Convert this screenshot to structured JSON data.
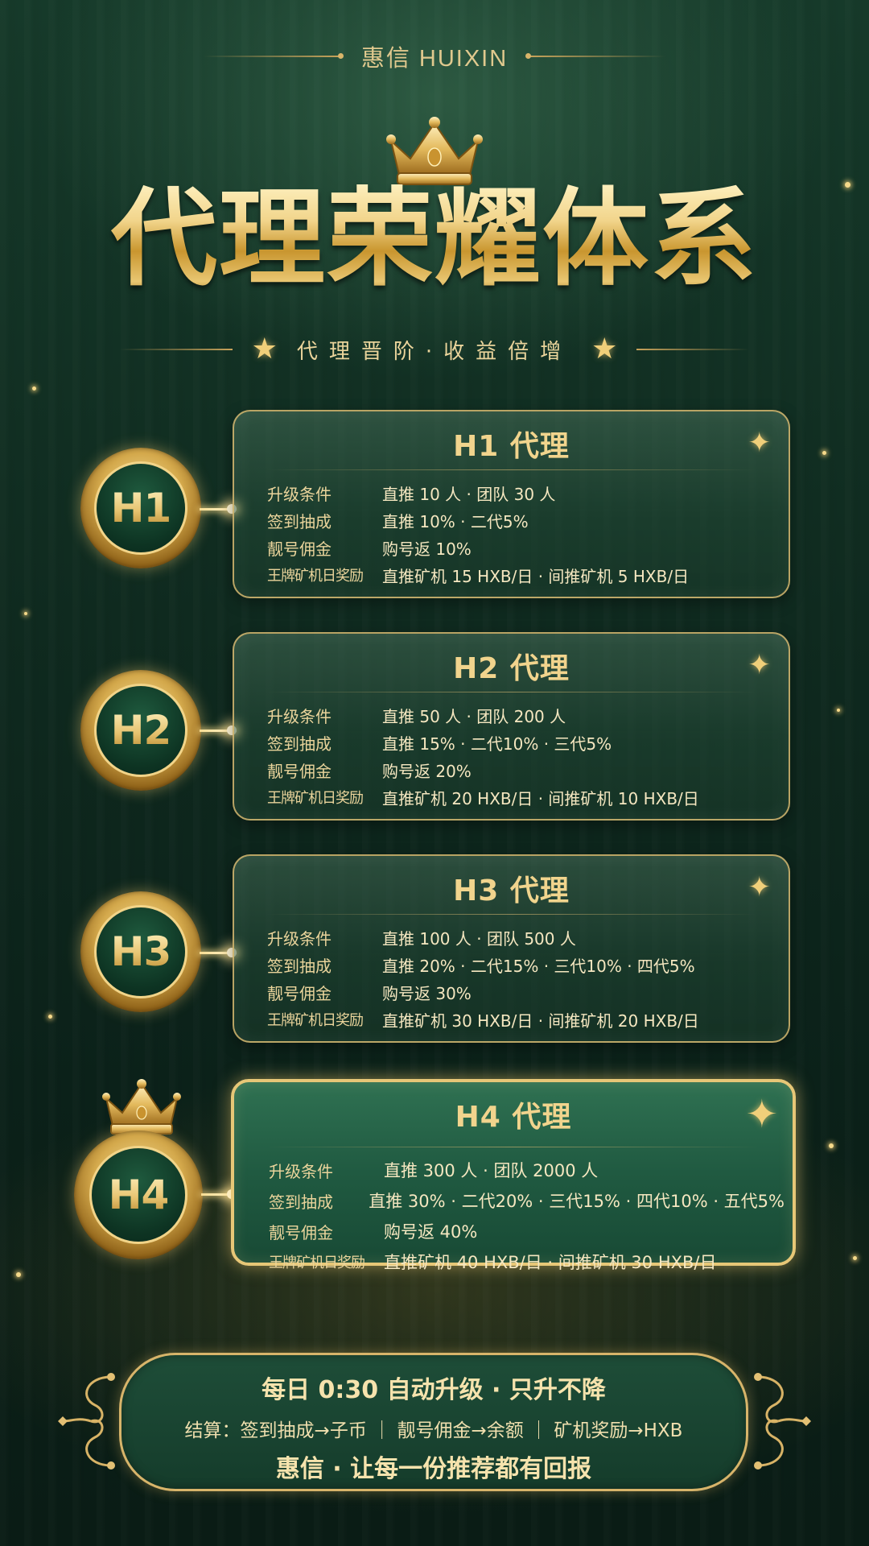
{
  "brand": "惠信 HUIXIN",
  "title": "代理荣耀体系",
  "subtitle": "代理晋阶·收益倍增",
  "levels": [
    {
      "badge": "H1",
      "title": "H1 代理",
      "rows": [
        {
          "label": "升级条件",
          "value": "直推 10 人 · 团队 30 人"
        },
        {
          "label": "签到抽成",
          "value": "直推 10% · 二代5%"
        },
        {
          "label": "靓号佣金",
          "value": "购号返 10%"
        },
        {
          "label": "王牌矿机日奖励",
          "value": "直推矿机 15 HXB/日 · 间推矿机 5 HXB/日"
        }
      ]
    },
    {
      "badge": "H2",
      "title": "H2 代理",
      "rows": [
        {
          "label": "升级条件",
          "value": "直推 50 人 · 团队 200 人"
        },
        {
          "label": "签到抽成",
          "value": "直推 15% · 二代10% · 三代5%"
        },
        {
          "label": "靓号佣金",
          "value": "购号返 20%"
        },
        {
          "label": "王牌矿机日奖励",
          "value": "直推矿机 20 HXB/日 · 间推矿机 10 HXB/日"
        }
      ]
    },
    {
      "badge": "H3",
      "title": "H3 代理",
      "rows": [
        {
          "label": "升级条件",
          "value": "直推 100 人 · 团队 500 人"
        },
        {
          "label": "签到抽成",
          "value": "直推 20% · 二代15% · 三代10% · 四代5%"
        },
        {
          "label": "靓号佣金",
          "value": "购号返 30%"
        },
        {
          "label": "王牌矿机日奖励",
          "value": "直推矿机 30 HXB/日 · 间推矿机 20 HXB/日"
        }
      ]
    },
    {
      "badge": "H4",
      "title": "H4 代理",
      "rows": [
        {
          "label": "升级条件",
          "value": "直推 300 人 · 团队 2000 人"
        },
        {
          "label": "签到抽成",
          "value": "直推 30% · 二代20% · 三代15% · 四代10% · 五代5%"
        },
        {
          "label": "靓号佣金",
          "value": "购号返 40%"
        },
        {
          "label": "王牌矿机日奖励",
          "value": "直推矿机 40 HXB/日 · 间推矿机 30 HXB/日"
        }
      ]
    }
  ],
  "footer": {
    "line1": "每日 0:30 自动升级 · 只升不降",
    "line2": "结算：签到抽成→子币 ｜ 靓号佣金→余额 ｜ 矿机奖励→HXB",
    "line3": "惠信 · 让每一份推荐都有回报"
  },
  "colors": {
    "background": "#0f2a1f",
    "gold": "#e7c777",
    "card_green": "#205a41"
  },
  "icons": [
    "crown-icon",
    "star-icon",
    "scroll-ornament-icon"
  ]
}
